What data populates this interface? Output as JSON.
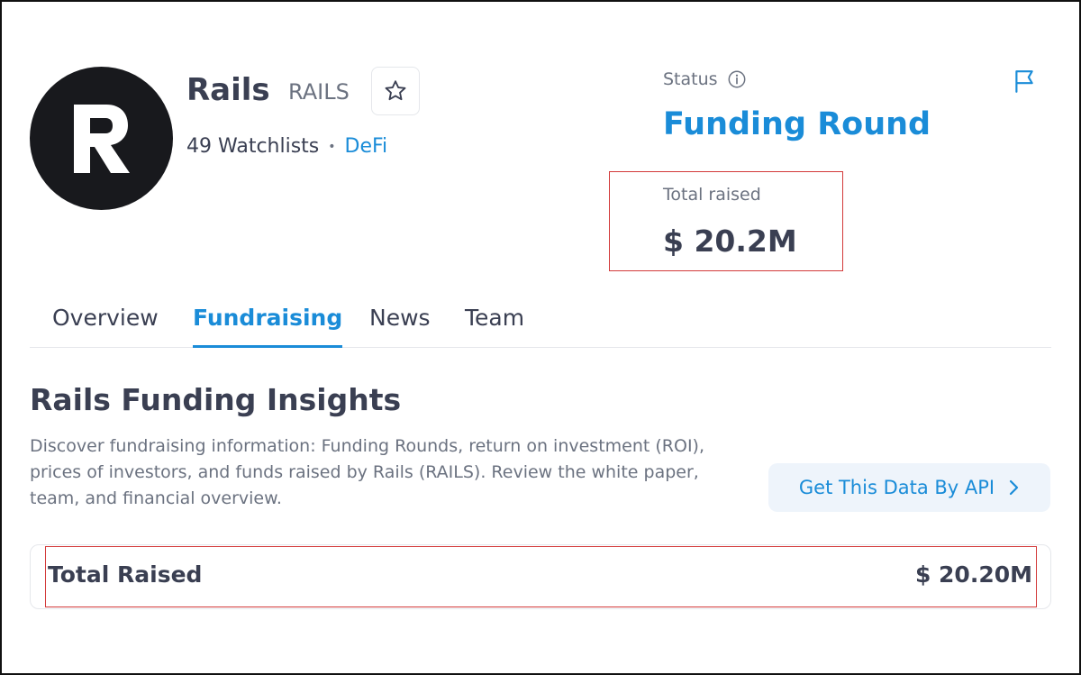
{
  "project": {
    "name": "Rails",
    "ticker": "RAILS",
    "watchlists": "49 Watchlists",
    "separator": "•",
    "category": "DeFi",
    "logo_letter": "R",
    "logo_icon": "rails-logo-icon",
    "star_icon": "star-outline-icon"
  },
  "status": {
    "label": "Status",
    "value": "Funding Round",
    "info_icon": "info-circle-icon",
    "flag_icon": "flag-icon"
  },
  "raised": {
    "label": "Total raised",
    "value": "$ 20.2M"
  },
  "tabs": [
    {
      "label": "Overview",
      "active": false
    },
    {
      "label": "Fundraising",
      "active": true
    },
    {
      "label": "News",
      "active": false
    },
    {
      "label": "Team",
      "active": false
    }
  ],
  "insights": {
    "title": "Rails Funding Insights",
    "description": "Discover fundraising information: Funding Rounds, return on investment (ROI), prices of investors, and funds raised by Rails (RAILS). Review the white paper, team, and financial overview.",
    "api_button": "Get This Data By API",
    "chevron_icon": "chevron-right-icon"
  },
  "summary": {
    "label": "Total Raised",
    "value": "$ 20.20M"
  },
  "colors": {
    "accent": "#1a8cd8",
    "heading": "#3a3f52",
    "muted": "#6b7280",
    "highlight": "#d33a3a",
    "logo_bg": "#18191d"
  }
}
